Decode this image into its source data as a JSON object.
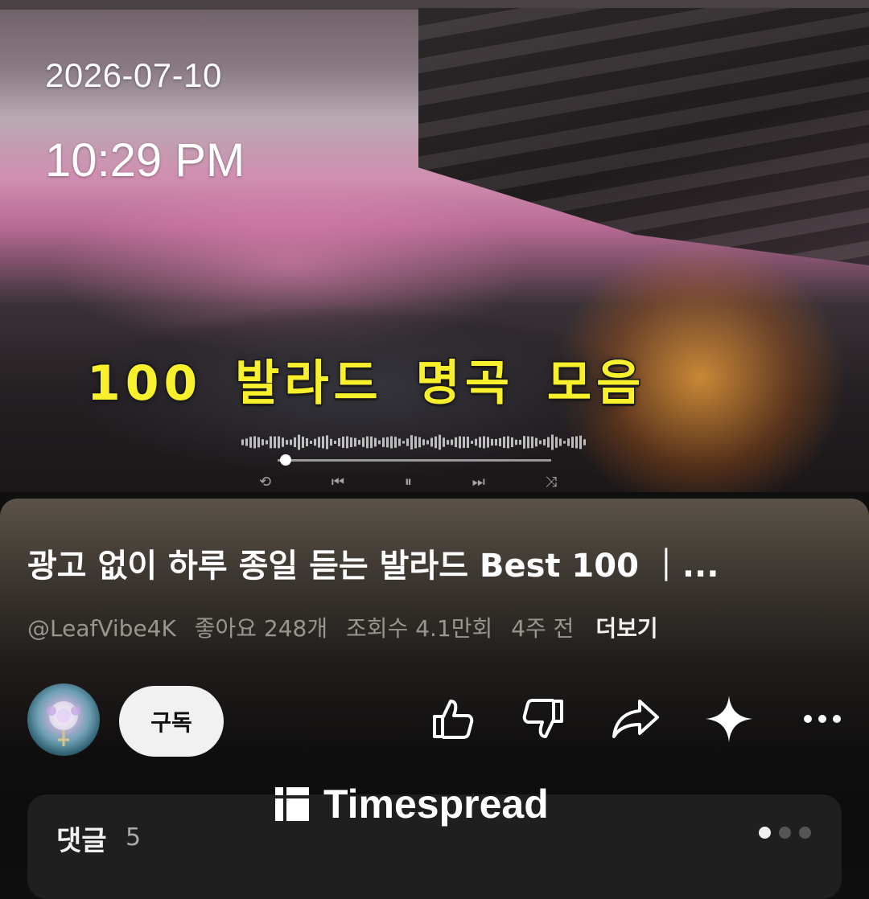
{
  "overlay": {
    "date": "2026-07-10",
    "time": "10:29 PM"
  },
  "video": {
    "caption": "100 발라드 명곡 모음",
    "progress": 0.03,
    "controls": [
      "repeat-icon",
      "previous-icon",
      "pause-icon",
      "next-icon",
      "shuffle-icon"
    ]
  },
  "info": {
    "title": "광고 없이 하루 종일 듣는 발라드 Best 100 ｜...",
    "channel": "@LeafVibe4K",
    "likes": "좋아요 248개",
    "views": "조회수 4.1만회",
    "age": "4주 전",
    "more": "더보기"
  },
  "actions": {
    "subscribe_label": "구독",
    "icons": [
      "like-icon",
      "dislike-icon",
      "share-icon",
      "remix-icon",
      "more-options-icon"
    ]
  },
  "comments": {
    "label": "댓글",
    "count": "5",
    "pager": {
      "total": 3,
      "active": 1
    }
  },
  "watermark": {
    "text": "Timespread"
  },
  "colors": {
    "caption_fill": "#f7f02a",
    "subscribe_bg": "#f1f1f1",
    "panel_bg": "#0f0f0f"
  }
}
